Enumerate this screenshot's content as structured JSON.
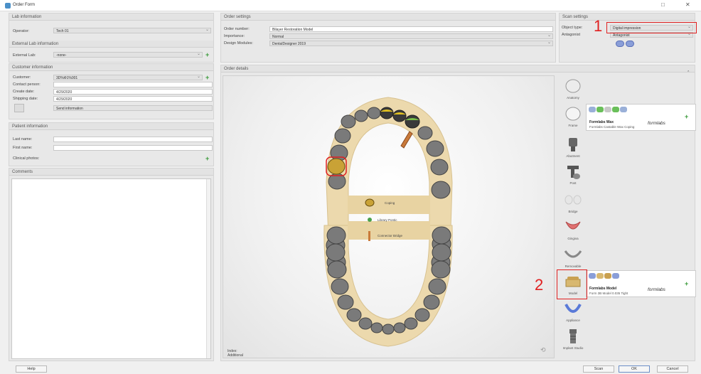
{
  "window": {
    "title": "Order Form",
    "minimize": "—",
    "restore": "□",
    "close": "✕"
  },
  "lab_info": {
    "header": "Lab information",
    "operator_label": "Operator:",
    "operator_value": "Tech 01",
    "external_header": "External Lab information",
    "external_label": "External Lab:",
    "external_value": "-none-"
  },
  "customer_info": {
    "header": "Customer information",
    "customer_label": "Customer:",
    "customer_value": "3D%Ф1%001",
    "contact_label": "Contact person:",
    "contact_value": "",
    "create_label": "Create date:",
    "create_value": "4/29/2020",
    "shipping_label": "Shipping date:",
    "shipping_value": "4/29/2020",
    "send_info": "Send information"
  },
  "patient_info": {
    "header": "Patient information",
    "last_label": "Last name:",
    "first_label": "First name:",
    "photos_label": "Clinical photos:"
  },
  "comments": {
    "header": "Comments"
  },
  "order_settings": {
    "header": "Order settings",
    "number_label": "Order number:",
    "number_value": "Bilayer Restoration Model",
    "importance_label": "Importance:",
    "importance_value": "Normal",
    "modules_label": "Design Modules:",
    "modules_value": "DentalDesigner 2019"
  },
  "scan_settings": {
    "header": "Scan settings",
    "object_label": "Object type:",
    "object_value": "Digital impression",
    "antagonist_label": "Antagonist",
    "antagonist_value": "Antagonist"
  },
  "order_details": {
    "header": "Order details",
    "collapse": "‸",
    "index_label": "Index:",
    "additional_label": "Additional"
  },
  "legend": {
    "coping": "Coping",
    "library": "Library Pontic",
    "connector": "Connector Bridge"
  },
  "tools": {
    "anatomy": "Anatomy",
    "frame": "Frame",
    "abutment": "Abutment",
    "post": "Post",
    "bridge": "Bridge",
    "gingiva": "Gingiva",
    "removable": "Removable",
    "model": "Model",
    "appliance": "Appliance",
    "implant": "Implant Studio"
  },
  "frame_material": {
    "name": "Formlabs Wax",
    "sub": "Formlabs Castable Wax Coping",
    "logo": "formlabs"
  },
  "model_material": {
    "name": "Formlabs Model",
    "sub": "Form 3B Model 0.035 Tight",
    "logo": "formlabs"
  },
  "annotations": {
    "one": "1",
    "two": "2"
  },
  "footer": {
    "left_button": "Help",
    "scan": "Scan",
    "ok": "OK",
    "cancel": "Cancel"
  },
  "colors": {
    "accent_red": "#e02020",
    "arch_tan": "#ecd9ad",
    "plus_green": "#3a9a3a"
  }
}
